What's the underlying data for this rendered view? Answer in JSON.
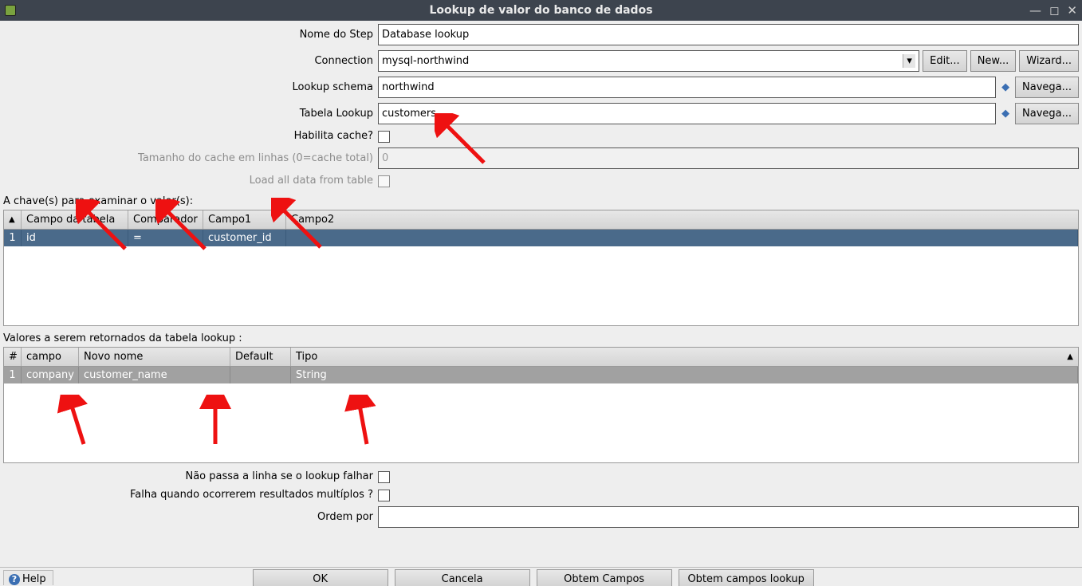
{
  "window": {
    "title": "Lookup de valor do banco de dados"
  },
  "labels": {
    "step_name": "Nome do Step",
    "connection": "Connection",
    "lookup_schema": "Lookup schema",
    "lookup_table": "Tabela Lookup",
    "enable_cache": "Habilita cache?",
    "cache_size": "Tamanho do cache em linhas (0=cache total)",
    "load_all": "Load all data from table",
    "keys_section": "A chave(s) para examinar o valor(s):",
    "return_section": "Valores a serem retornados da tabela lookup :",
    "no_pass": "Não passa a linha se o lookup falhar",
    "fail_multi": "Falha quando ocorrerem resultados multíplos ?",
    "order_by": "Ordem por"
  },
  "fields": {
    "step_name": "Database lookup",
    "connection": "mysql-northwind",
    "lookup_schema": "northwind",
    "lookup_table": "customers",
    "cache_size": "0",
    "order_by": ""
  },
  "buttons": {
    "edit": "Edit...",
    "new": "New...",
    "wizard": "Wizard...",
    "browse": "Navega...",
    "help": "Help",
    "ok": "OK",
    "cancel": "Cancela",
    "get_fields": "Obtem Campos",
    "get_lookup_fields": "Obtem campos lookup"
  },
  "table1": {
    "headers": {
      "num": "#",
      "field_table": "Campo da tabela",
      "comparator": "Comparador",
      "field1": "Campo1",
      "field2": "Campo2"
    },
    "rows": [
      {
        "num": "1",
        "field_table": "id",
        "comparator": "=",
        "field1": "customer_id",
        "field2": ""
      }
    ]
  },
  "table2": {
    "headers": {
      "num": "#",
      "field": "campo",
      "new_name": "Novo nome",
      "default": "Default",
      "type": "Tipo"
    },
    "rows": [
      {
        "num": "1",
        "field": "company",
        "new_name": "customer_name",
        "default": "",
        "type": "String"
      }
    ]
  }
}
